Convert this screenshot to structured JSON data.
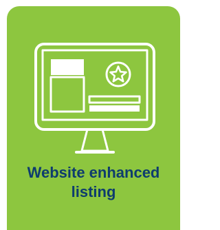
{
  "card": {
    "background_color": "#8dc63f",
    "illustration_icon": "computer-monitor-with-star-icon",
    "illustration_stroke_color": "#ffffff",
    "caption_lines": [
      "Website enhanced",
      "listing"
    ],
    "caption_color": "#0e3c6e"
  }
}
